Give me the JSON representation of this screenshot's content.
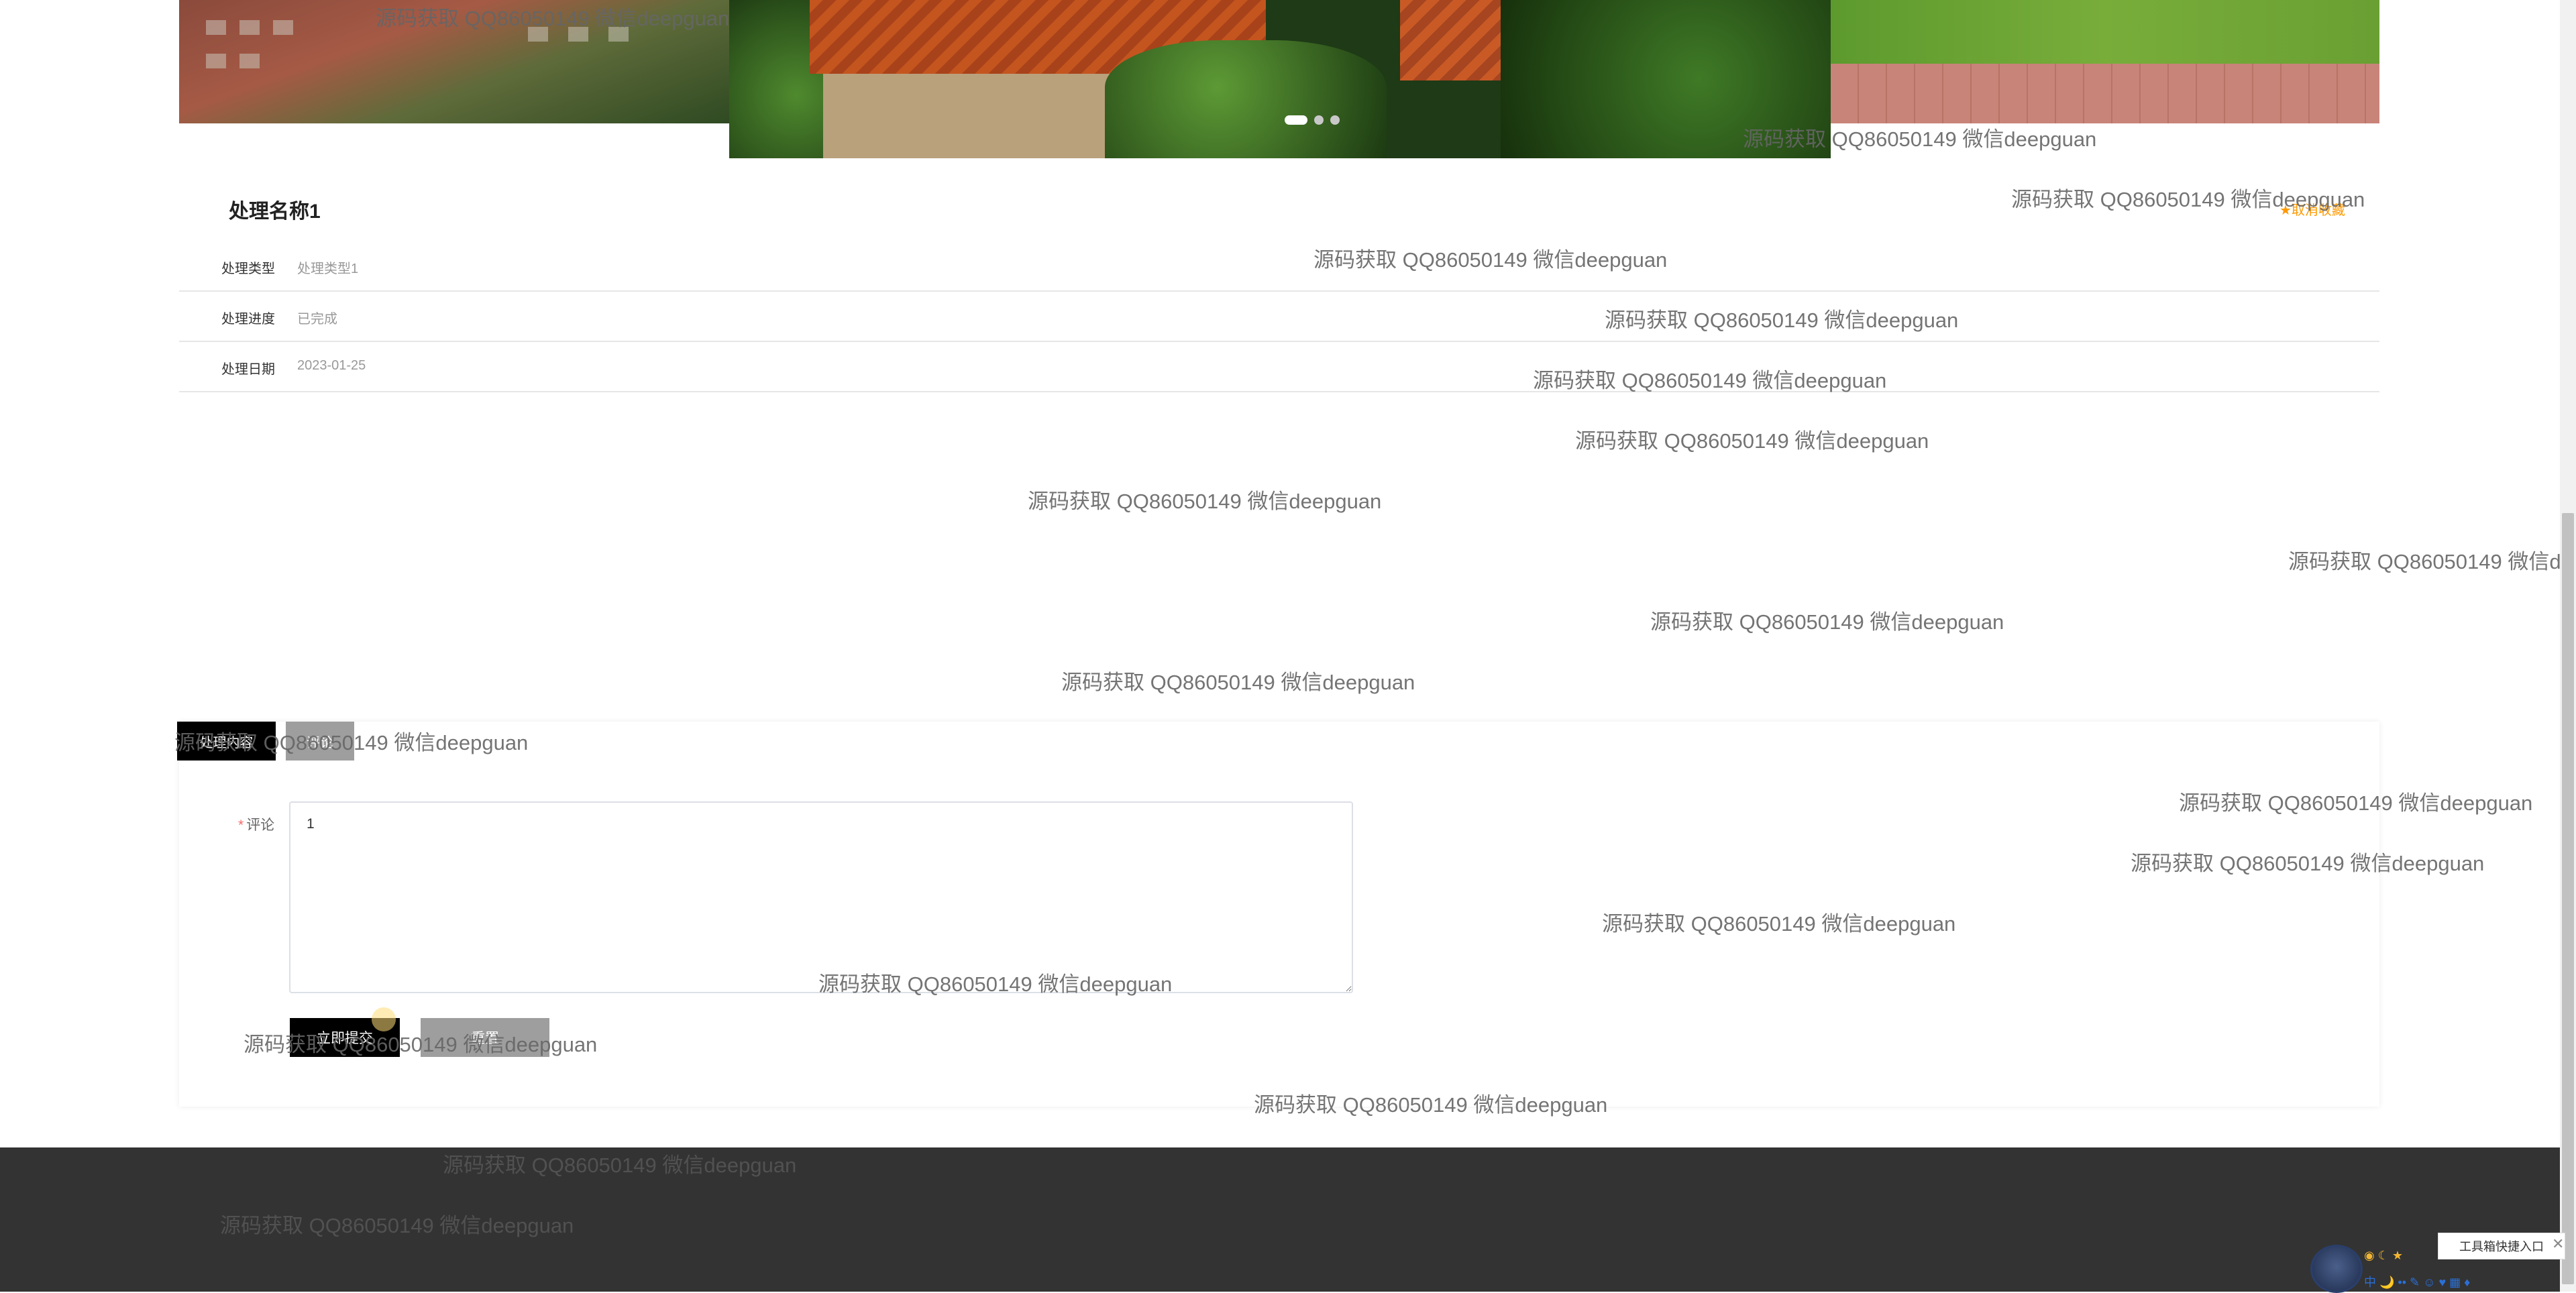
{
  "detail": {
    "title": "处理名称1",
    "favorite_label": "★取消收藏",
    "rows": [
      {
        "key": "处理类型",
        "value": "处理类型1"
      },
      {
        "key": "处理进度",
        "value": "已完成"
      },
      {
        "key": "处理日期",
        "value": "2023-01-25"
      }
    ]
  },
  "carousel": {
    "active_index": 0,
    "count": 3
  },
  "tabs": {
    "content": "处理内容",
    "comment": "评论"
  },
  "form": {
    "comment_label": "评论",
    "required_mark": "*",
    "comment_value": "1",
    "submit_label": "立即提交",
    "reset_label": "重置"
  },
  "watermark": "源码获取 QQ86050149 微信deepguan",
  "widget": {
    "toolbox_label": "工具箱快捷入口",
    "close": "✕",
    "icons_text": "中 🌙 •• ✎ ☺ ♥ ▦ ♦",
    "weather": "◉ ☾ ★"
  },
  "colors": {
    "accent": "#000000",
    "secondary": "#9e9e9e",
    "favorite": "#ff9900",
    "footer": "#333333"
  }
}
